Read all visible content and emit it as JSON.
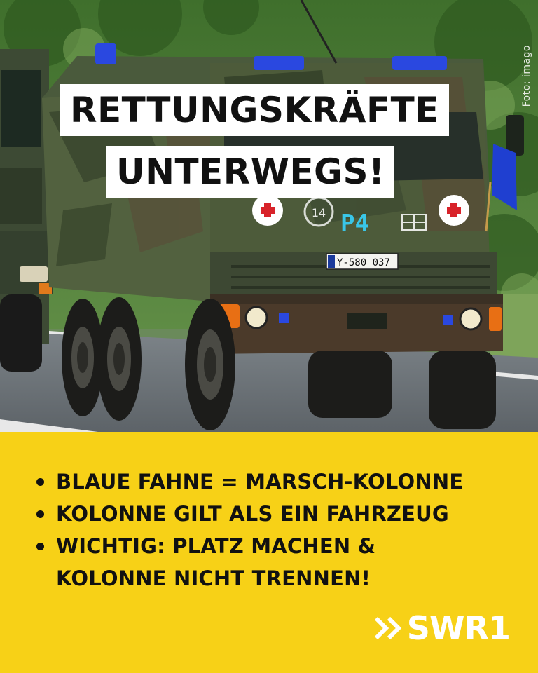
{
  "photo": {
    "credit": "Foto: imago",
    "plate": "Y-580 037",
    "hood_number": "14",
    "hood_mark": "P4",
    "colors": {
      "sky_foliage": "#4c7a38",
      "road": "#6e7479",
      "truck_green": "#4a5a3c",
      "truck_brown": "#5b4a36",
      "flag_blue": "#1f3fd0"
    }
  },
  "headline": {
    "line1": "RETTUNGSKRÄFTE",
    "line2": "UNTERWEGS!"
  },
  "info": {
    "background": "#f7d117",
    "bullets": [
      {
        "line1": "BLAUE FAHNE = MARSCH-KOLONNE",
        "line2": ""
      },
      {
        "line1": "KOLONNE GILT ALS EIN FAHRZEUG",
        "line2": ""
      },
      {
        "line1": "WICHTIG: PLATZ MACHEN &",
        "line2": "KOLONNE NICHT TRENNEN!"
      }
    ],
    "logo": {
      "text": "SWR1",
      "icon": "double-chevron-icon"
    }
  }
}
